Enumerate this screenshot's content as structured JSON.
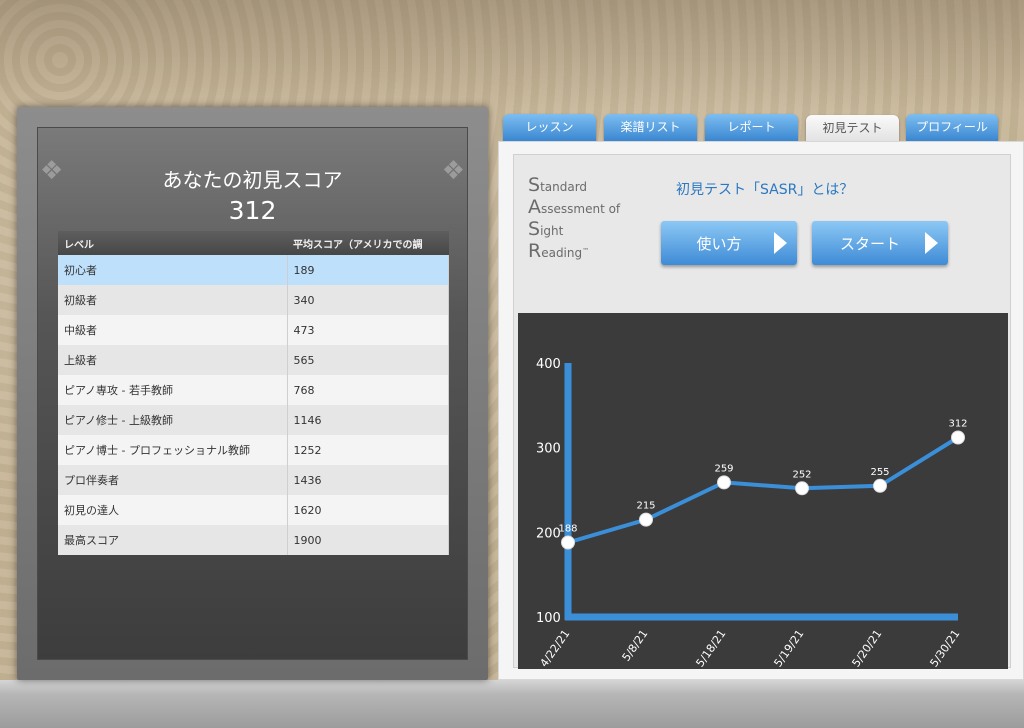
{
  "score_panel": {
    "title": "あなたの初見スコア",
    "score": "312",
    "table": {
      "headers": [
        "レベル",
        "平均スコア（アメリカでの調"
      ],
      "rows": [
        {
          "level": "初心者",
          "score": "189"
        },
        {
          "level": "初級者",
          "score": "340"
        },
        {
          "level": "中級者",
          "score": "473"
        },
        {
          "level": "上級者",
          "score": "565"
        },
        {
          "level": "ピアノ専攻 - 若手教師",
          "score": "768"
        },
        {
          "level": "ピアノ修士 - 上級教師",
          "score": "1146"
        },
        {
          "level": "ピアノ博士 - プロフェッショナル教師",
          "score": "1252"
        },
        {
          "level": "プロ伴奏者",
          "score": "1436"
        },
        {
          "level": "初見の達人",
          "score": "1620"
        },
        {
          "level": "最高スコア",
          "score": "1900"
        }
      ],
      "selected_index": 0
    }
  },
  "tabs": [
    {
      "label": "レッスン",
      "active": false
    },
    {
      "label": "楽譜リスト",
      "active": false
    },
    {
      "label": "レポート",
      "active": false
    },
    {
      "label": "初見テスト",
      "active": true
    },
    {
      "label": "プロフィール",
      "active": false
    }
  ],
  "logo": {
    "lines": [
      {
        "initial": "S",
        "rest": "tandard"
      },
      {
        "initial": "A",
        "rest": "ssessment of"
      },
      {
        "initial": "S",
        "rest": "ight"
      },
      {
        "initial": "R",
        "rest": "eading"
      }
    ],
    "tm": "™"
  },
  "sasr_link": "初見テスト「SASR」とは？",
  "buttons": {
    "how_to": "使い方",
    "start": "スタート"
  },
  "chart_data": {
    "type": "line",
    "categories": [
      "4/22/21",
      "5/8/21",
      "5/18/21",
      "5/19/21",
      "5/20/21",
      "5/30/21"
    ],
    "values": [
      188,
      215,
      259,
      252,
      255,
      312
    ],
    "data_labels": [
      "188",
      "215",
      "259",
      "252",
      "255",
      "312"
    ],
    "yticks": [
      100,
      200,
      300,
      400
    ],
    "ylim": [
      100,
      400
    ],
    "title": "",
    "xlabel": "",
    "ylabel": "",
    "grid": false,
    "colors": {
      "line": "#3b8fd9",
      "background": "#3b3b3b",
      "point": "#ffffff",
      "text": "#ffffff"
    }
  },
  "colors": {
    "accent": "#3a86d0",
    "selected_row": "#bfe0fb"
  }
}
